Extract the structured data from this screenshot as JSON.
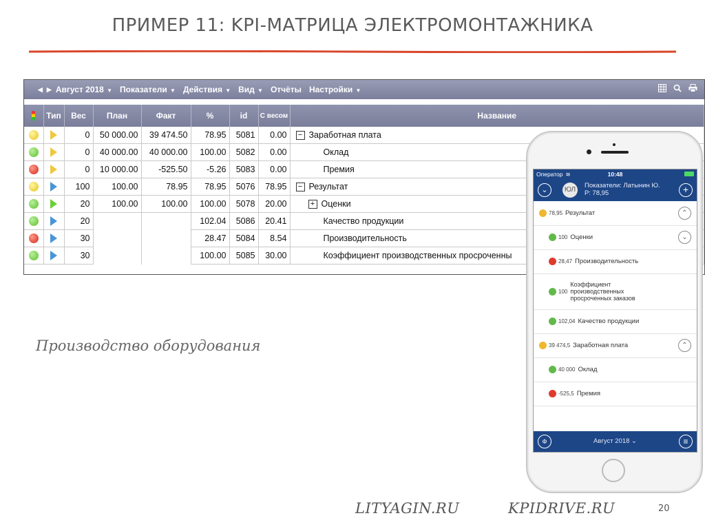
{
  "slide": {
    "title": "ПРИМЕР 11: KPI-МАТРИЦА ЭЛЕКТРОМОНТАЖНИКА",
    "subtitle": "Производство оборудования",
    "footer_left": "LITYAGIN.RU",
    "footer_right": "KPIDRIVE.RU",
    "page_number": "20",
    "accent_color": "#d9462a"
  },
  "toolbar": {
    "period": "Август 2018",
    "menus": [
      "Показатели",
      "Действия",
      "Вид",
      "Отчёты",
      "Настройки"
    ],
    "icons": [
      "table-icon",
      "search-icon",
      "print-icon"
    ]
  },
  "table": {
    "headers": [
      "",
      "Тип",
      "Вес",
      "План",
      "Факт",
      "%",
      "id",
      "С весом",
      "Название"
    ],
    "rows": [
      {
        "status": "yellow",
        "type": "yellow",
        "weight": "0",
        "plan": "50 000.00",
        "fact": "39 474.50",
        "pct": "78.95",
        "id": "5081",
        "weighted": "0.00",
        "name": "Заработная плата",
        "tree": "minus",
        "indent": 0
      },
      {
        "status": "green",
        "type": "yellow",
        "weight": "0",
        "plan": "40 000.00",
        "fact": "40 000.00",
        "pct": "100.00",
        "id": "5082",
        "weighted": "0.00",
        "name": "Оклад",
        "tree": "",
        "indent": 2
      },
      {
        "status": "red",
        "type": "yellow",
        "weight": "0",
        "plan": "10 000.00",
        "fact": "-525.50",
        "pct": "-5.26",
        "id": "5083",
        "weighted": "0.00",
        "name": "Премия",
        "tree": "",
        "indent": 2
      },
      {
        "status": "yellow",
        "type": "blue",
        "weight": "100",
        "plan": "100.00",
        "fact": "78.95",
        "pct": "78.95",
        "id": "5076",
        "weighted": "78.95",
        "name": "Результат",
        "tree": "minus",
        "indent": 0
      },
      {
        "status": "green",
        "type": "green",
        "weight": "20",
        "plan": "100.00",
        "fact": "100.00",
        "pct": "100.00",
        "id": "5078",
        "weighted": "20.00",
        "name": "Оценки",
        "tree": "plus",
        "indent": 1
      },
      {
        "status": "green",
        "type": "blue",
        "weight": "20",
        "plan": "",
        "fact": "",
        "pct": "102.04",
        "id": "5086",
        "weighted": "20.41",
        "name": "Качество продукции",
        "tree": "",
        "indent": 2
      },
      {
        "status": "red",
        "type": "blue",
        "weight": "30",
        "plan": "",
        "fact": "",
        "pct": "28.47",
        "id": "5084",
        "weighted": "8.54",
        "name": "Производительность",
        "tree": "",
        "indent": 2
      },
      {
        "status": "green",
        "type": "blue",
        "weight": "30",
        "plan": "",
        "fact": "",
        "pct": "100.00",
        "id": "5085",
        "weighted": "30.00",
        "name": "Коэффициент производственных просроченны",
        "tree": "",
        "indent": 2
      }
    ]
  },
  "phone": {
    "carrier": "Оператор",
    "time": "10:48",
    "avatar": "ЮЛ",
    "header_line1": "Показатели: Латынин Ю.",
    "header_line2": "Р: 78,95",
    "items": [
      {
        "color": "yellow",
        "value": "78,95",
        "name": "Результат",
        "chevron": "up",
        "indent": 0
      },
      {
        "color": "green",
        "value": "100",
        "name": "Оценки",
        "chevron": "down",
        "indent": 1
      },
      {
        "color": "red",
        "value": "28,47",
        "name": "Производительность",
        "chevron": "",
        "indent": 1
      },
      {
        "color": "green",
        "value": "100",
        "name": "Коэффициент производственных просроченных заказов",
        "chevron": "",
        "indent": 1
      },
      {
        "color": "green",
        "value": "102,04",
        "name": "Качество продукции",
        "chevron": "",
        "indent": 1
      },
      {
        "color": "yellow",
        "value": "39 474,5",
        "name": "Заработная плата",
        "chevron": "up",
        "indent": 0
      },
      {
        "color": "green",
        "value": "40 000",
        "name": "Оклад",
        "chevron": "",
        "indent": 1
      },
      {
        "color": "red",
        "value": "-525,5",
        "name": "Премия",
        "chevron": "",
        "indent": 1
      }
    ],
    "bottom_label": "Август 2018 ⌄"
  }
}
